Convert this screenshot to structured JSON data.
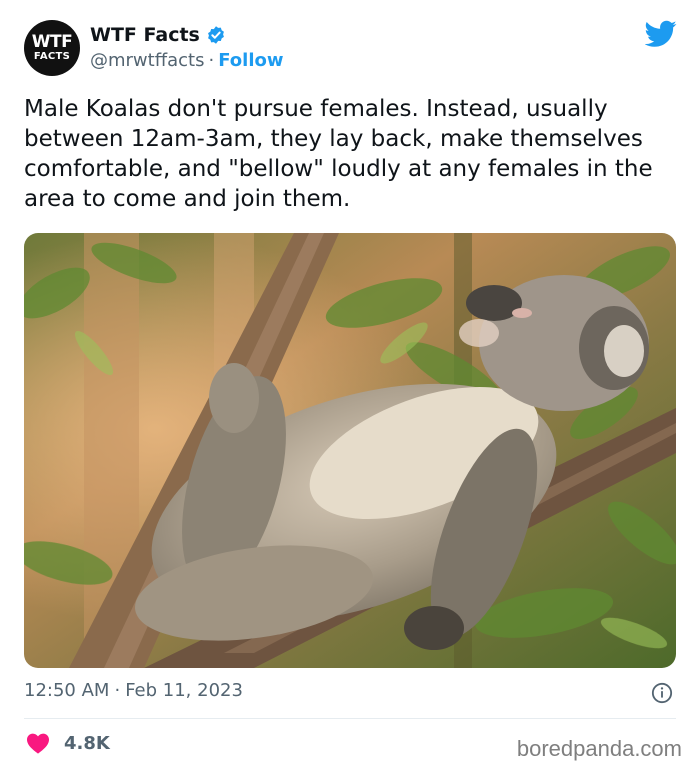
{
  "account": {
    "avatar_line1": "WTF",
    "avatar_line2": "FACTS",
    "display_name": "WTF Facts",
    "handle": "@mrwtffacts",
    "separator": "·",
    "follow_label": "Follow"
  },
  "tweet": {
    "text": "Male Koalas don't pursue females. Instead, usually between 12am-3am, they lay back, make themselves comfortable, and \"bellow\" loudly at any females in the area to come and join them.",
    "time": "12:50 AM",
    "date": "Feb 11, 2023",
    "separator": "·",
    "like_count": "4.8K"
  },
  "watermark": "boredpanda.com",
  "icons": {
    "platform": "twitter-bird-icon",
    "verified": "verified-badge-icon",
    "info": "info-icon",
    "like": "heart-icon"
  },
  "colors": {
    "brand_blue": "#1d9bf0",
    "like_pink": "#f91880",
    "text_primary": "#0f1419",
    "text_secondary": "#536471"
  }
}
